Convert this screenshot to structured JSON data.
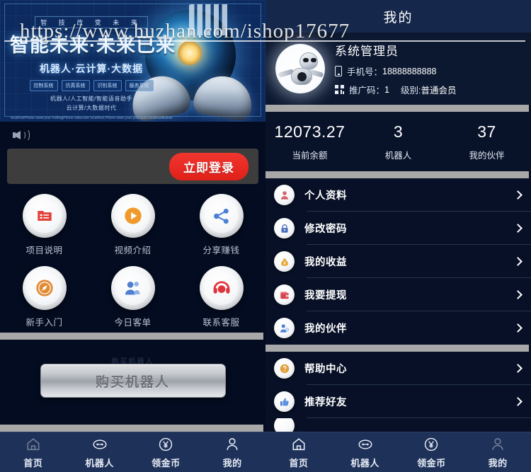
{
  "watermark": {
    "text": "https://www.huzhan.com/ishop17677"
  },
  "left": {
    "banner": {
      "tag_top": "智 技 改 变 未 来",
      "title": "智能未来·未来已来",
      "subtitle": "机器人·云计算·大数据",
      "tags": [
        "控制系统",
        "仿真系统",
        "识别系统",
        "服务系统"
      ],
      "line1": "机器人/人工智能/智能语音助手",
      "line2": "云计算/大数据时代",
      "url_note": "localhostPhone www.your hotBagPhone www.size localhost.Phone www your your size localhostBotnet www"
    },
    "announce": {
      "icon": "speaker-icon",
      "login_label": "立即登录"
    },
    "grid": [
      {
        "label": "项目说明",
        "icon": "folder-list-icon",
        "color": "#e0453c"
      },
      {
        "label": "视频介绍",
        "icon": "play-circle-icon",
        "color": "#ef9a2a"
      },
      {
        "label": "分享赚钱",
        "icon": "share-nodes-icon",
        "color": "#4a7fd4"
      },
      {
        "label": "新手入门",
        "icon": "compass-icon",
        "color": "#e08b33"
      },
      {
        "label": "今日客单",
        "icon": "user-group-icon",
        "color": "#4f7fd0"
      },
      {
        "label": "联系客服",
        "icon": "headset-icon",
        "color": "#e0343c"
      }
    ],
    "buy": {
      "label": "购买机器人",
      "ghost": "购买机器人"
    },
    "tabs": [
      {
        "label": "首页",
        "icon": "home-icon",
        "active": true
      },
      {
        "label": "机器人",
        "icon": "robot-icon",
        "active": false
      },
      {
        "label": "领金币",
        "icon": "yuan-coin-icon",
        "active": false
      },
      {
        "label": "我的",
        "icon": "user-icon",
        "active": false
      }
    ]
  },
  "right": {
    "header": {
      "title": "我的"
    },
    "profile": {
      "avatar": "robot-avatar",
      "name": "系统管理员",
      "phone_label": "手机号：",
      "phone_value": "18888888888",
      "promo_label": "推广码：",
      "promo_value": "1",
      "level_label": "级别:",
      "level_value": "普通会员"
    },
    "stats": [
      {
        "value": "12073.27",
        "label": "当前余额"
      },
      {
        "value": "3",
        "label": "机器人"
      },
      {
        "value": "37",
        "label": "我的伙伴"
      }
    ],
    "menu_group_1": [
      {
        "label": "个人资料",
        "icon": "user-profile-icon"
      },
      {
        "label": "修改密码",
        "icon": "lock-icon"
      },
      {
        "label": "我的收益",
        "icon": "money-bag-icon"
      },
      {
        "label": "我要提现",
        "icon": "wallet-icon"
      },
      {
        "label": "我的伙伴",
        "icon": "partners-icon"
      }
    ],
    "menu_group_2": [
      {
        "label": "帮助中心",
        "icon": "question-circle-icon"
      },
      {
        "label": "推荐好友",
        "icon": "thumbs-up-icon"
      }
    ],
    "tabs": [
      {
        "label": "首页",
        "icon": "home-icon",
        "active": false
      },
      {
        "label": "机器人",
        "icon": "robot-icon",
        "active": false
      },
      {
        "label": "领金币",
        "icon": "yuan-coin-icon",
        "active": false
      },
      {
        "label": "我的",
        "icon": "user-icon",
        "active": true
      }
    ]
  },
  "colors": {
    "bg_dark": "#071026",
    "header_blue": "#15274a",
    "tabbar_blue": "#1e3158",
    "separator_gray": "#a8a8a8",
    "login_red": "#e32019"
  }
}
